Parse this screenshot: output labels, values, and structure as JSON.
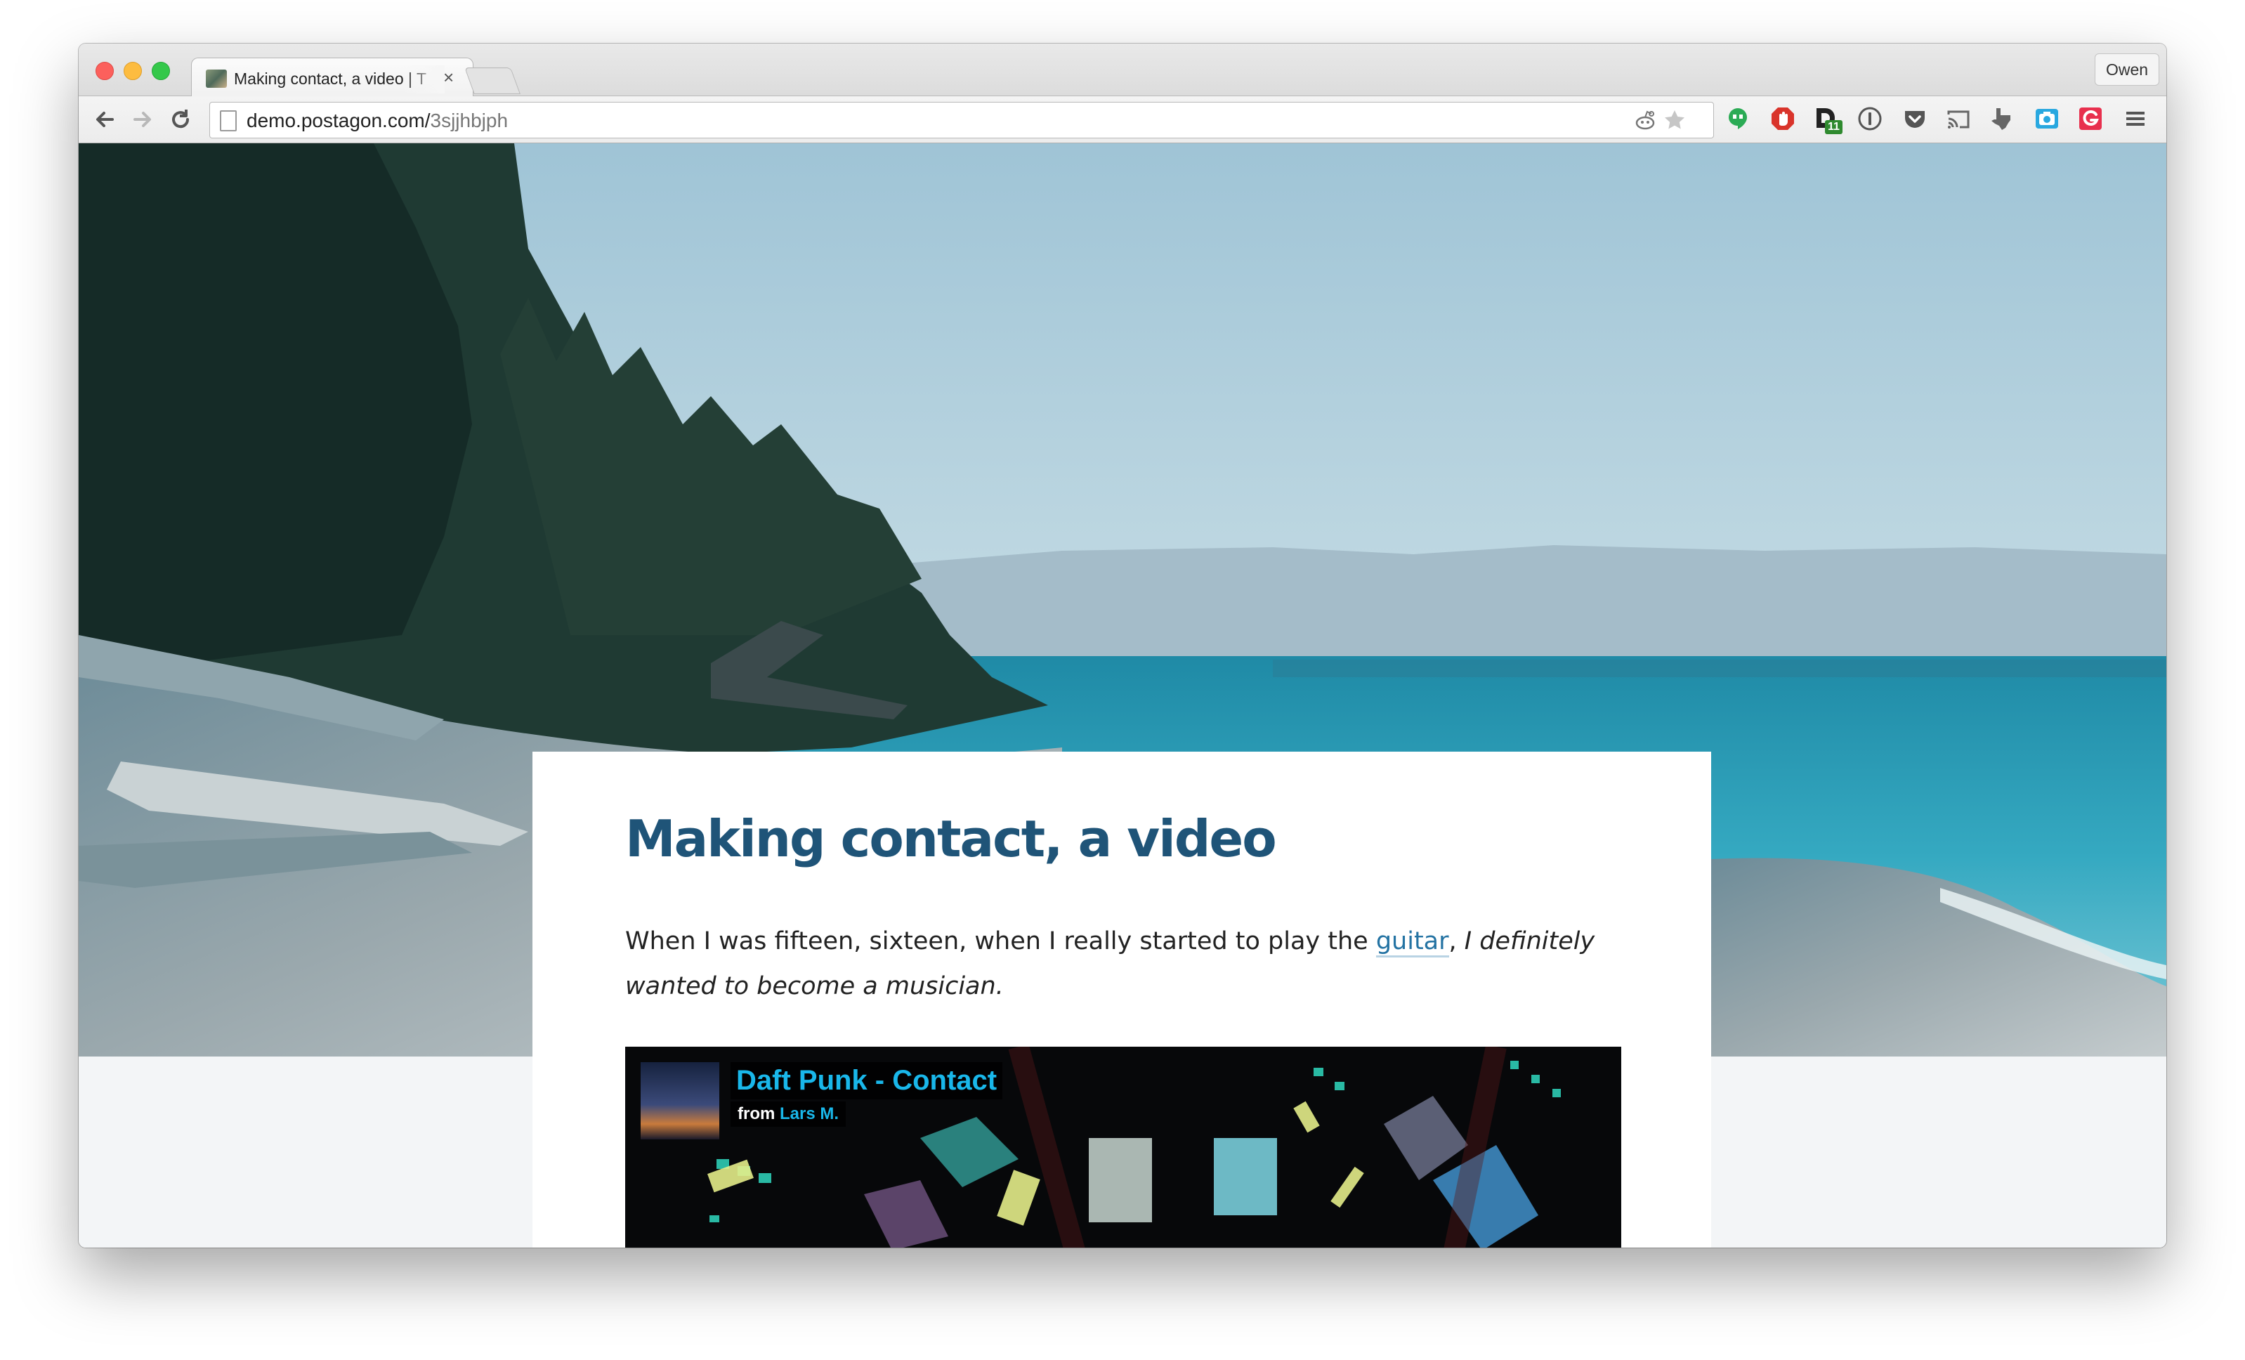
{
  "browser": {
    "tab": {
      "title": "Making contact, a video | T",
      "close_glyph": "×"
    },
    "profile_name": "Owen",
    "url_host": "demo.postagon.com/",
    "url_path": "3sjjhbjph",
    "extension_badge": "11"
  },
  "post": {
    "title": "Making contact, a video",
    "body_before_link": "When I was fifteen, sixteen, when I really started to play the ",
    "link_text": "guitar",
    "body_after_link": ", ",
    "body_italic": "I definitely wanted to become a musician."
  },
  "video": {
    "title": "Daft Punk - Contact",
    "from_label": "from ",
    "author": "Lars M."
  },
  "colors": {
    "title": "#1f5478",
    "link": "#2473a3",
    "video_accent": "#19b7ea",
    "page_bg": "#f3f5f7"
  }
}
